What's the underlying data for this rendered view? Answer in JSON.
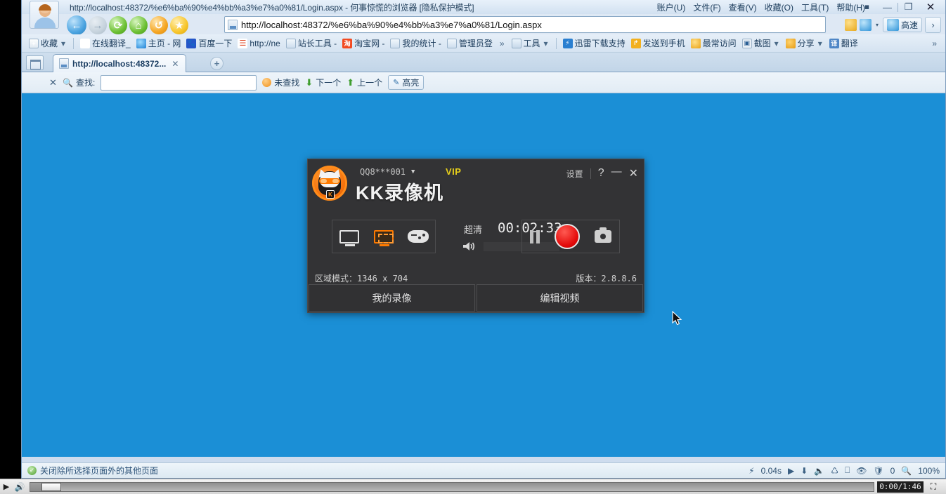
{
  "browser": {
    "title": "http://localhost:48372/%e6%ba%90%e4%bb%a3%e7%a0%81/Login.aspx - 何事惊慌的浏览器 [隐私保护模式]",
    "menus": [
      {
        "label": "账户(U)"
      },
      {
        "label": "文件(F)"
      },
      {
        "label": "查看(V)"
      },
      {
        "label": "收藏(O)"
      },
      {
        "label": "工具(T)"
      },
      {
        "label": "帮助(H)"
      }
    ],
    "window_controls": {
      "skin": "皮肤",
      "minimize": "—",
      "restore": "❐",
      "close": "✕"
    },
    "nav": {
      "back": "←",
      "forward": "→",
      "reload": "⟳",
      "home": "⌂",
      "history": "↺",
      "favorite": "★"
    },
    "address": {
      "url": "http://localhost:48372/%e6%ba%90%e4%bb%a3%e7%a0%81/Login.aspx",
      "speed_label": "高速",
      "go": "›"
    },
    "bookmarks": [
      {
        "label": "收藏",
        "icon": "add-favorite-icon",
        "caret": true
      },
      {
        "label": "在线翻译_",
        "icon": "yahoo-icon"
      },
      {
        "label": "主页 - 网",
        "icon": "moon-icon"
      },
      {
        "label": "百度一下",
        "icon": "baidu-icon"
      },
      {
        "label": "http://ne",
        "icon": "chart-icon"
      },
      {
        "label": "站长工具 -",
        "icon": "page-icon"
      },
      {
        "label": "淘宝网 -",
        "icon": "taobao-icon"
      },
      {
        "label": "我的统计 -",
        "icon": "page-icon"
      },
      {
        "label": "管理员登",
        "icon": "page-icon"
      }
    ],
    "bookmarks_overflow": "»",
    "toolbar_right": [
      {
        "label": "工具",
        "icon": "toolbox-icon",
        "caret": true
      },
      {
        "label": "迅雷下载支持",
        "icon": "thunder-icon"
      },
      {
        "label": "发送到手机",
        "icon": "send-phone-icon"
      },
      {
        "label": "最常访问",
        "icon": "frequent-icon"
      },
      {
        "label": "截图",
        "icon": "screenshot-icon",
        "caret": true
      },
      {
        "label": "分享",
        "icon": "share-icon",
        "caret": true
      },
      {
        "label": "翻译",
        "icon": "translate-icon"
      }
    ],
    "toolbar_overflow": "»",
    "tab": {
      "label": "http://localhost:48372...",
      "close": "✕",
      "new_tab": "+"
    },
    "findbar": {
      "close": "✕",
      "label": "查找:",
      "input_value": "",
      "input_placeholder": "",
      "status": "未查找",
      "next": "下一个",
      "prev": "上一个",
      "highlight": "高亮"
    },
    "status": {
      "message": "关闭除所选择页面外的其他页面",
      "load_time": "0.04s",
      "block_count": "0",
      "zoom": "100%"
    }
  },
  "kk": {
    "account": "QQ8***001",
    "vip": "VIP",
    "app_title": "KK录像机",
    "settings": "设置",
    "help": "?",
    "minimize": "—",
    "close": "✕",
    "modes": [
      {
        "name": "full-screen-mode",
        "label": "全屏录制",
        "selected": false
      },
      {
        "name": "region-mode",
        "label": "区域录制",
        "selected": true
      },
      {
        "name": "game-mode",
        "label": "游戏录制",
        "selected": false
      }
    ],
    "quality": "超清",
    "timer": "00:02:33",
    "actions": {
      "pause": "暂停",
      "record": "录制",
      "snapshot": "截图"
    },
    "mode_info": "区域模式：1346 x 704",
    "version": "版本：2.8.8.6",
    "footer": [
      {
        "label": "我的录像"
      },
      {
        "label": "编辑视频"
      }
    ]
  },
  "player": {
    "play": "▶",
    "volume": "🔊",
    "time": "0:00/1:46",
    "fullscreen": "⛶"
  },
  "colors": {
    "page_background": "#1b8fd6",
    "kk_window": "#333335",
    "kk_accent": "#ff7a00",
    "record_red": "#e40a0a",
    "vip_gold": "#e8d01a"
  }
}
